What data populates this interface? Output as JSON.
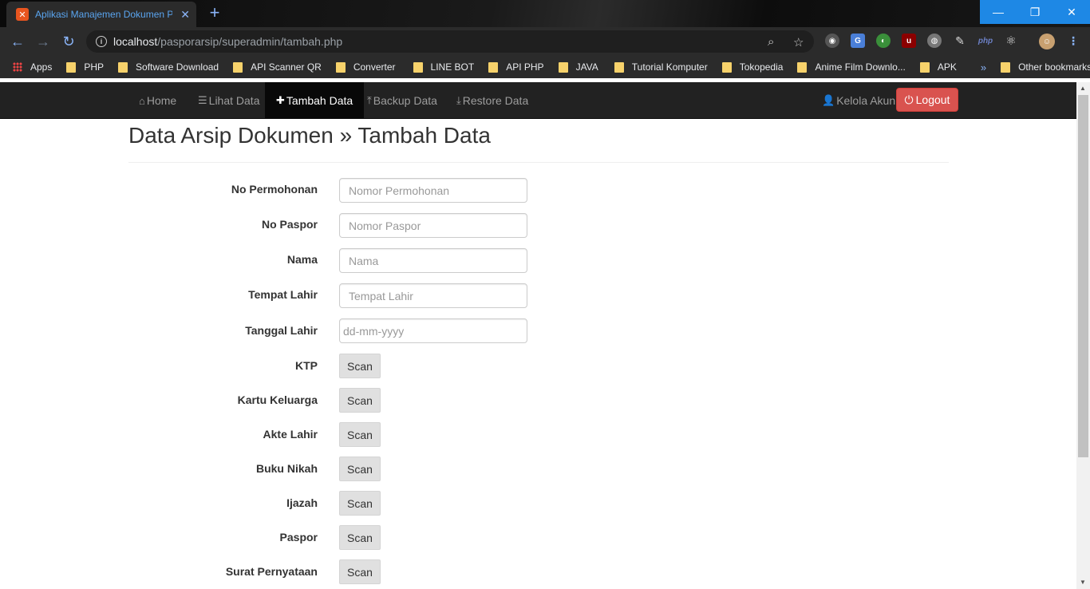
{
  "browser": {
    "tab_title": "Aplikasi Manajemen Dokumen Pa",
    "url_host": "localhost",
    "url_path": "/pasporarsip/superadmin/tambah.php",
    "bookmarks": [
      {
        "label": "Apps",
        "icon": "apps-grid-icon"
      },
      {
        "label": "PHP",
        "icon": "folder-icon"
      },
      {
        "label": "Software Download",
        "icon": "folder-icon"
      },
      {
        "label": "API Scanner QR",
        "icon": "folder-icon"
      },
      {
        "label": "Converter",
        "icon": "folder-icon"
      },
      {
        "label": "LINE BOT",
        "icon": "folder-icon"
      },
      {
        "label": "API PHP",
        "icon": "folder-icon"
      },
      {
        "label": "JAVA",
        "icon": "folder-icon"
      },
      {
        "label": "Tutorial Komputer",
        "icon": "folder-icon"
      },
      {
        "label": "Tokopedia",
        "icon": "folder-icon"
      },
      {
        "label": "Anime Film Downlo...",
        "icon": "folder-icon"
      },
      {
        "label": "APK",
        "icon": "folder-icon"
      }
    ],
    "bookmarks_overflow": "»",
    "other_bookmarks": "Other bookmarks"
  },
  "nav": {
    "home": "Home",
    "lihat_data": "Lihat Data",
    "tambah_data": "Tambah Data",
    "backup_data": "Backup Data",
    "restore_data": "Restore Data",
    "kelola_akun": "Kelola Akun",
    "logout": "Logout"
  },
  "page": {
    "title": "Data Arsip Dokumen » Tambah Data"
  },
  "form": {
    "no_permohonan": {
      "label": "No Permohonan",
      "placeholder": "Nomor Permohonan"
    },
    "no_paspor": {
      "label": "No Paspor",
      "placeholder": "Nomor Paspor"
    },
    "nama": {
      "label": "Nama",
      "placeholder": "Nama"
    },
    "tempat_lahir": {
      "label": "Tempat Lahir",
      "placeholder": "Tempat Lahir"
    },
    "tanggal_lahir": {
      "label": "Tanggal Lahir",
      "placeholder": "dd-mm-yyyy"
    },
    "scan_label": "Scan",
    "documents": {
      "ktp": "KTP",
      "kartu_keluarga": "Kartu Keluarga",
      "akte_lahir": "Akte Lahir",
      "buku_nikah": "Buku Nikah",
      "ijazah": "Ijazah",
      "paspor": "Paspor",
      "surat_pernyataan": "Surat Pernyataan"
    }
  },
  "colors": {
    "navbar_bg": "#222222",
    "nav_active_bg": "#080808",
    "logout_bg": "#d9534f",
    "scan_btn_bg": "#e0e0e0"
  }
}
